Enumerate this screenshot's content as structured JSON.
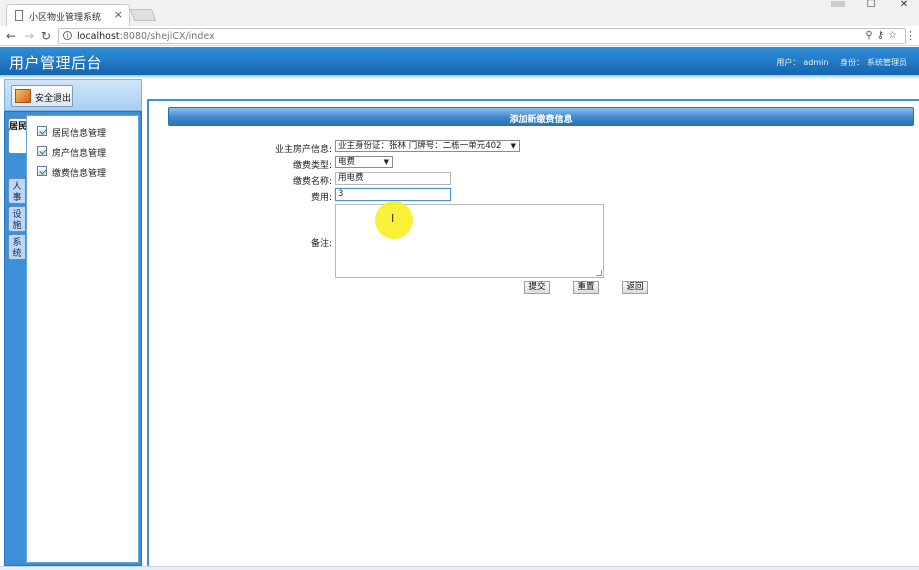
{
  "browser": {
    "tab_title": "小区物业管理系统",
    "tab_close": "×",
    "url_host": "localhost",
    "url_path": ":8080/shejiCX/index",
    "win_min": "—",
    "win_max": "☐",
    "win_close": "✕"
  },
  "header": {
    "title": "用户管理后台",
    "user_label": "用户：",
    "user_name": "admin",
    "role_label": "身份：",
    "role_name": "系统管理员"
  },
  "sidebar": {
    "logout_label": "安全退出",
    "vtabs": [
      {
        "label": "居民"
      },
      {
        "label": "人事"
      },
      {
        "label": "设施"
      },
      {
        "label": "系统"
      }
    ],
    "items": [
      {
        "label": "居民信息管理"
      },
      {
        "label": "房产信息管理"
      },
      {
        "label": "缴费信息管理"
      }
    ]
  },
  "form": {
    "title": "添加新缴费信息",
    "owner_label": "业主房产信息:",
    "owner_value": "业主身份证：张林    门牌号：二栋一单元402",
    "fee_type_label": "缴费类型:",
    "fee_type_value": "电费",
    "fee_name_label": "缴费名称:",
    "fee_name_value": "用电费",
    "fee_label": "费用:",
    "fee_value": "3",
    "note_label": "备注:",
    "note_value": "",
    "submit_label": "提交",
    "reset_label": "重置",
    "back_label": "返回"
  }
}
